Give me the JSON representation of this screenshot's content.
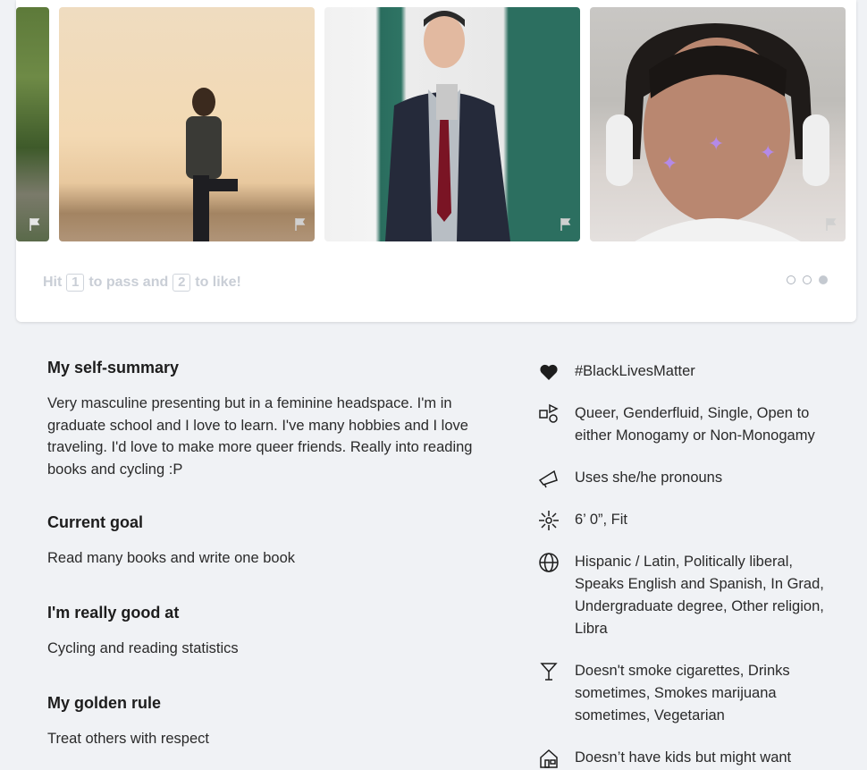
{
  "carousel": {
    "hint_prefix": "Hit",
    "key_pass": "1",
    "hint_middle": "to pass and",
    "key_like": "2",
    "hint_suffix": "to like!",
    "pages": 3,
    "active_page": 3
  },
  "essays": [
    {
      "title": "My self-summary",
      "text": "Very masculine presenting but in a feminine headspace. I'm in graduate school and I love to learn. I've many hobbies and I love traveling. I'd love to make more queer friends. Really into reading books and cycling :P"
    },
    {
      "title": "Current goal",
      "text": "Read many books and write one book"
    },
    {
      "title": "I'm really good at",
      "text": "Cycling and reading statistics"
    },
    {
      "title": "My golden rule",
      "text": "Treat others with respect"
    }
  ],
  "details": [
    {
      "icon": "heart-icon",
      "text": "#BlackLivesMatter"
    },
    {
      "icon": "shapes-icon",
      "text": "Queer, Genderfluid, Single, Open to either Monogamy or Non-Monogamy"
    },
    {
      "icon": "megaphone-icon",
      "text": "Uses she/he pronouns"
    },
    {
      "icon": "sparkle-icon",
      "text": "6’ 0”, Fit"
    },
    {
      "icon": "globe-icon",
      "text": "Hispanic / Latin, Politically liberal, Speaks English and Spanish, In Grad, Undergraduate degree, Other religion, Libra"
    },
    {
      "icon": "cocktail-icon",
      "text": "Doesn't smoke cigarettes, Drinks sometimes, Smokes marijuana sometimes, Vegetarian"
    },
    {
      "icon": "house-icon",
      "text": "Doesn’t have kids but might want"
    }
  ],
  "colors": {
    "background": "#f0f2f5",
    "card": "#ffffff",
    "hint": "#c9ced6"
  }
}
